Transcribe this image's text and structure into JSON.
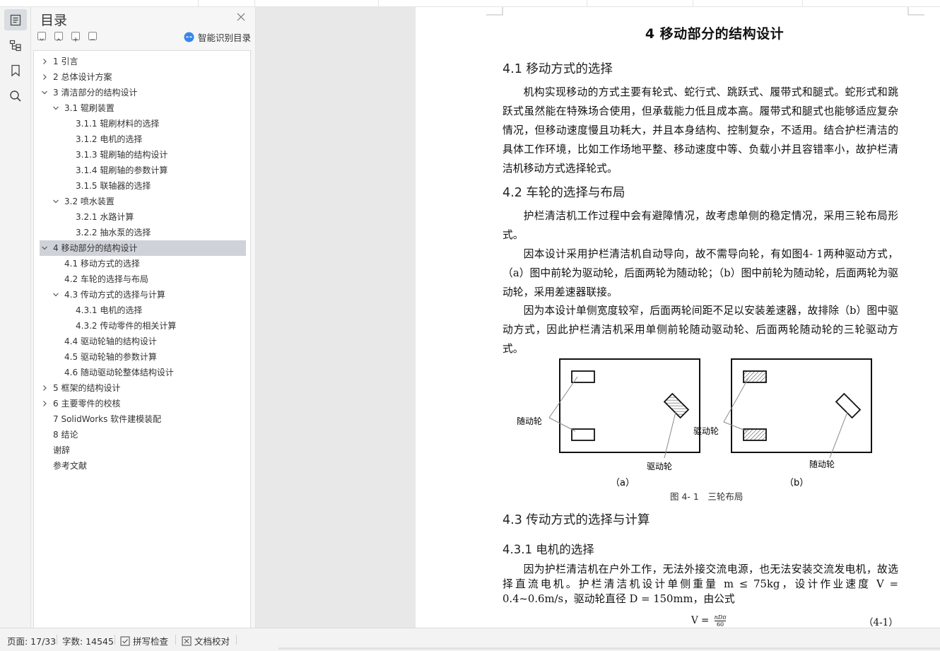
{
  "toc": {
    "title": "目录",
    "smart_label": "智能识别目录",
    "items": [
      {
        "label": "1 引言",
        "level": 1,
        "chevron": "right"
      },
      {
        "label": "2 总体设计方案",
        "level": 1,
        "chevron": "right"
      },
      {
        "label": "3 清洁部分的结构设计",
        "level": 1,
        "chevron": "down"
      },
      {
        "label": "3.1 辊刷装置",
        "level": 2,
        "chevron": "down"
      },
      {
        "label": "3.1.1 辊刷材料的选择",
        "level": 3,
        "chevron": "none"
      },
      {
        "label": "3.1.2 电机的选择",
        "level": 3,
        "chevron": "none"
      },
      {
        "label": "3.1.3 辊刷轴的结构设计",
        "level": 3,
        "chevron": "none"
      },
      {
        "label": "3.1.4 辊刷轴的参数计算",
        "level": 3,
        "chevron": "none"
      },
      {
        "label": "3.1.5 联轴器的选择",
        "level": 3,
        "chevron": "none"
      },
      {
        "label": "3.2 喷水装置",
        "level": 2,
        "chevron": "down"
      },
      {
        "label": "3.2.1 水路计算",
        "level": 3,
        "chevron": "none"
      },
      {
        "label": "3.2.2 抽水泵的选择",
        "level": 3,
        "chevron": "none"
      },
      {
        "label": "4 移动部分的结构设计",
        "level": 1,
        "chevron": "down",
        "selected": true
      },
      {
        "label": "4.1 移动方式的选择",
        "level": 2,
        "chevron": "none"
      },
      {
        "label": "4.2 车轮的选择与布局",
        "level": 2,
        "chevron": "none"
      },
      {
        "label": "4.3 传动方式的选择与计算",
        "level": 2,
        "chevron": "down"
      },
      {
        "label": "4.3.1 电机的选择",
        "level": 3,
        "chevron": "none"
      },
      {
        "label": "4.3.2 传动零件的相关计算",
        "level": 3,
        "chevron": "none"
      },
      {
        "label": "4.4 驱动轮轴的结构设计",
        "level": 2,
        "chevron": "none"
      },
      {
        "label": "4.5 驱动轮轴的参数计算",
        "level": 2,
        "chevron": "none"
      },
      {
        "label": "4.6 随动驱动轮整体结构设计",
        "level": 2,
        "chevron": "none"
      },
      {
        "label": "5 框架的结构设计",
        "level": 1,
        "chevron": "right"
      },
      {
        "label": "6 主要零件的校核",
        "level": 1,
        "chevron": "right"
      },
      {
        "label": "7 SolidWorks 软件建模装配",
        "level": 1,
        "chevron": "none"
      },
      {
        "label": "8 结论",
        "level": 1,
        "chevron": "none"
      },
      {
        "label": "谢辞",
        "level": 1,
        "chevron": "none"
      },
      {
        "label": "参考文献",
        "level": 1,
        "chevron": "none"
      }
    ]
  },
  "doc": {
    "chapter_title": "4 移动部分的结构设计",
    "s41_title": "4.1 移动方式的选择",
    "s41_p1": "机构实现移动的方式主要有轮式、蛇行式、跳跃式、履带式和腿式。蛇形式和跳跃式虽然能在特殊场合使用，但承载能力低且成本高。履带式和腿式也能够适应复杂情况，但移动速度慢且功耗大，并且本身结构、控制复杂，不适用。结合护栏清洁的具体工作环境，比如工作场地平整、移动速度中等、负载小并且容错率小，故护栏清洁机移动方式选择轮式。",
    "s42_title": "4.2 车轮的选择与布局",
    "s42_p1": "护栏清洁机工作过程中会有避障情况，故考虑单侧的稳定情况，采用三轮布局形式。",
    "s42_p2": "因本设计采用护栏清洁机自动导向，故不需导向轮，有如图4- 1两种驱动方式，（a）图中前轮为驱动轮，后面两轮为随动轮；（b）图中前轮为随动轮，后面两轮为驱动轮，采用差速器联接。",
    "s42_p3": "因为本设计单侧宽度较窄，后面两轮间距不足以安装差速器，故排除（b）图中驱动方式，因此护栏清洁机采用单侧前轮随动驱动轮、后面两轮随动轮的三轮驱动方式。",
    "fig": {
      "a_label_left": "随动轮",
      "a_label_bottom": "驱动轮",
      "a_caption": "（a）",
      "b_label_left": "驱动轮",
      "b_label_bottom": "随动轮",
      "b_caption": "（b）",
      "caption": "图 4- 1　三轮布局"
    },
    "s43_title": "4.3 传动方式的选择与计算",
    "s431_title": "4.3.1 电机的选择",
    "s431_p1": "因为护栏清洁机在户外工作，无法外接交流电源，也无法安装交流发电机，故选择直流电机。护栏清洁机设计单侧重量 m ≤ 75kg，设计作业速度 V = 0.4~0.6m/s，驱动轮直径 D = 150mm，由公式",
    "formula_lhs": "V =",
    "formula_num": "nDπ",
    "formula_den": "60",
    "formula_no": "（4-1）"
  },
  "status": {
    "page": "页面: 17/33",
    "words": "字数: 14545",
    "spell": "拼写检查",
    "proof": "文档校对"
  }
}
